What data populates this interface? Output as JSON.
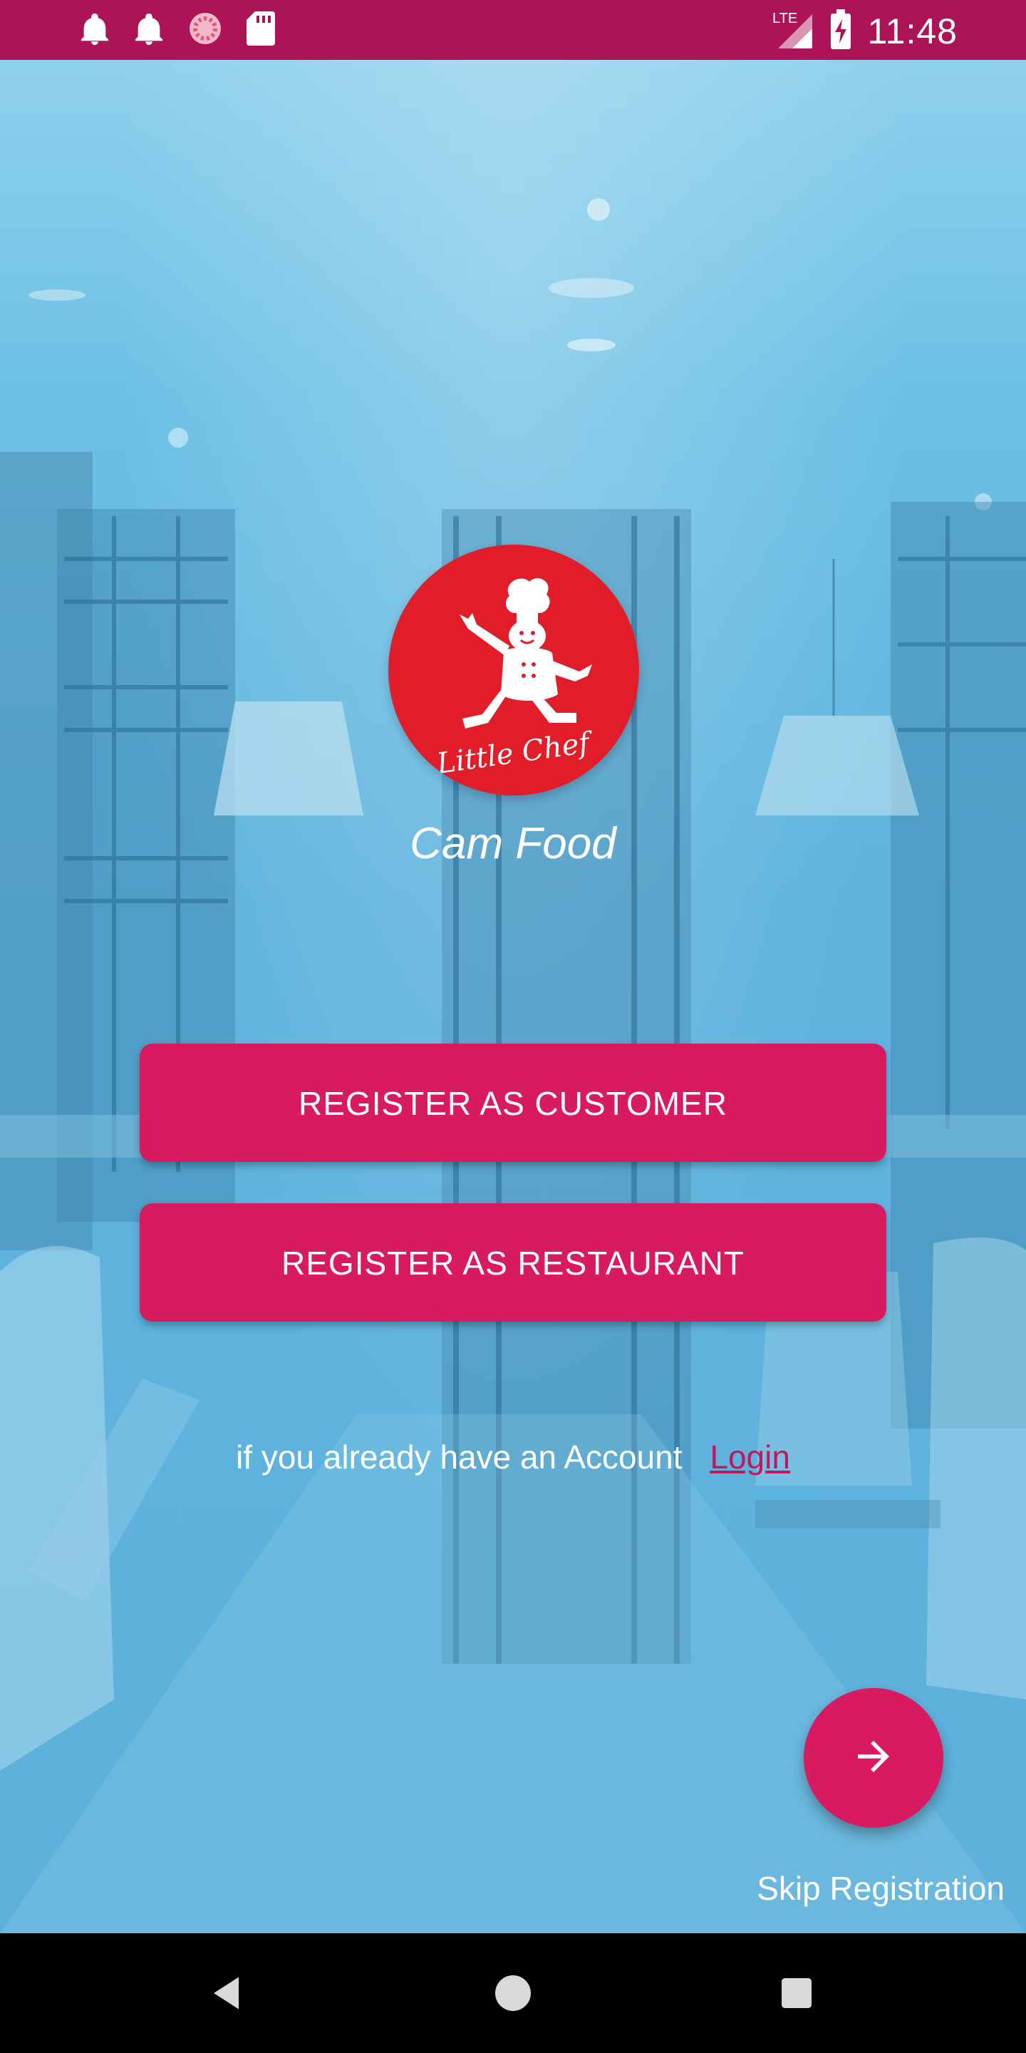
{
  "status_bar": {
    "time": "11:48",
    "network": "LTE",
    "left_icons": [
      "bell-icon",
      "bell-icon",
      "sync-icon",
      "sd-card-icon"
    ],
    "right_icons": [
      "lte-signal-icon",
      "battery-charging-icon"
    ]
  },
  "app": {
    "logo_text": "Little Chef",
    "name": "Cam Food"
  },
  "buttons": {
    "register_customer": "REGISTER AS CUSTOMER",
    "register_restaurant": "REGISTER AS RESTAURANT"
  },
  "login_prompt": {
    "message": "if you already have an Account",
    "link": "Login"
  },
  "skip": {
    "fab_icon": "arrow-right-icon",
    "label": "Skip Registration"
  },
  "nav_bar": {
    "buttons": [
      "back-icon",
      "home-icon",
      "recents-icon"
    ]
  },
  "colors": {
    "status_bar": "#ad1457",
    "accent": "#d81b60",
    "link": "#c2185b",
    "logo": "#e11d2a",
    "overlay": "#5fb6df"
  }
}
